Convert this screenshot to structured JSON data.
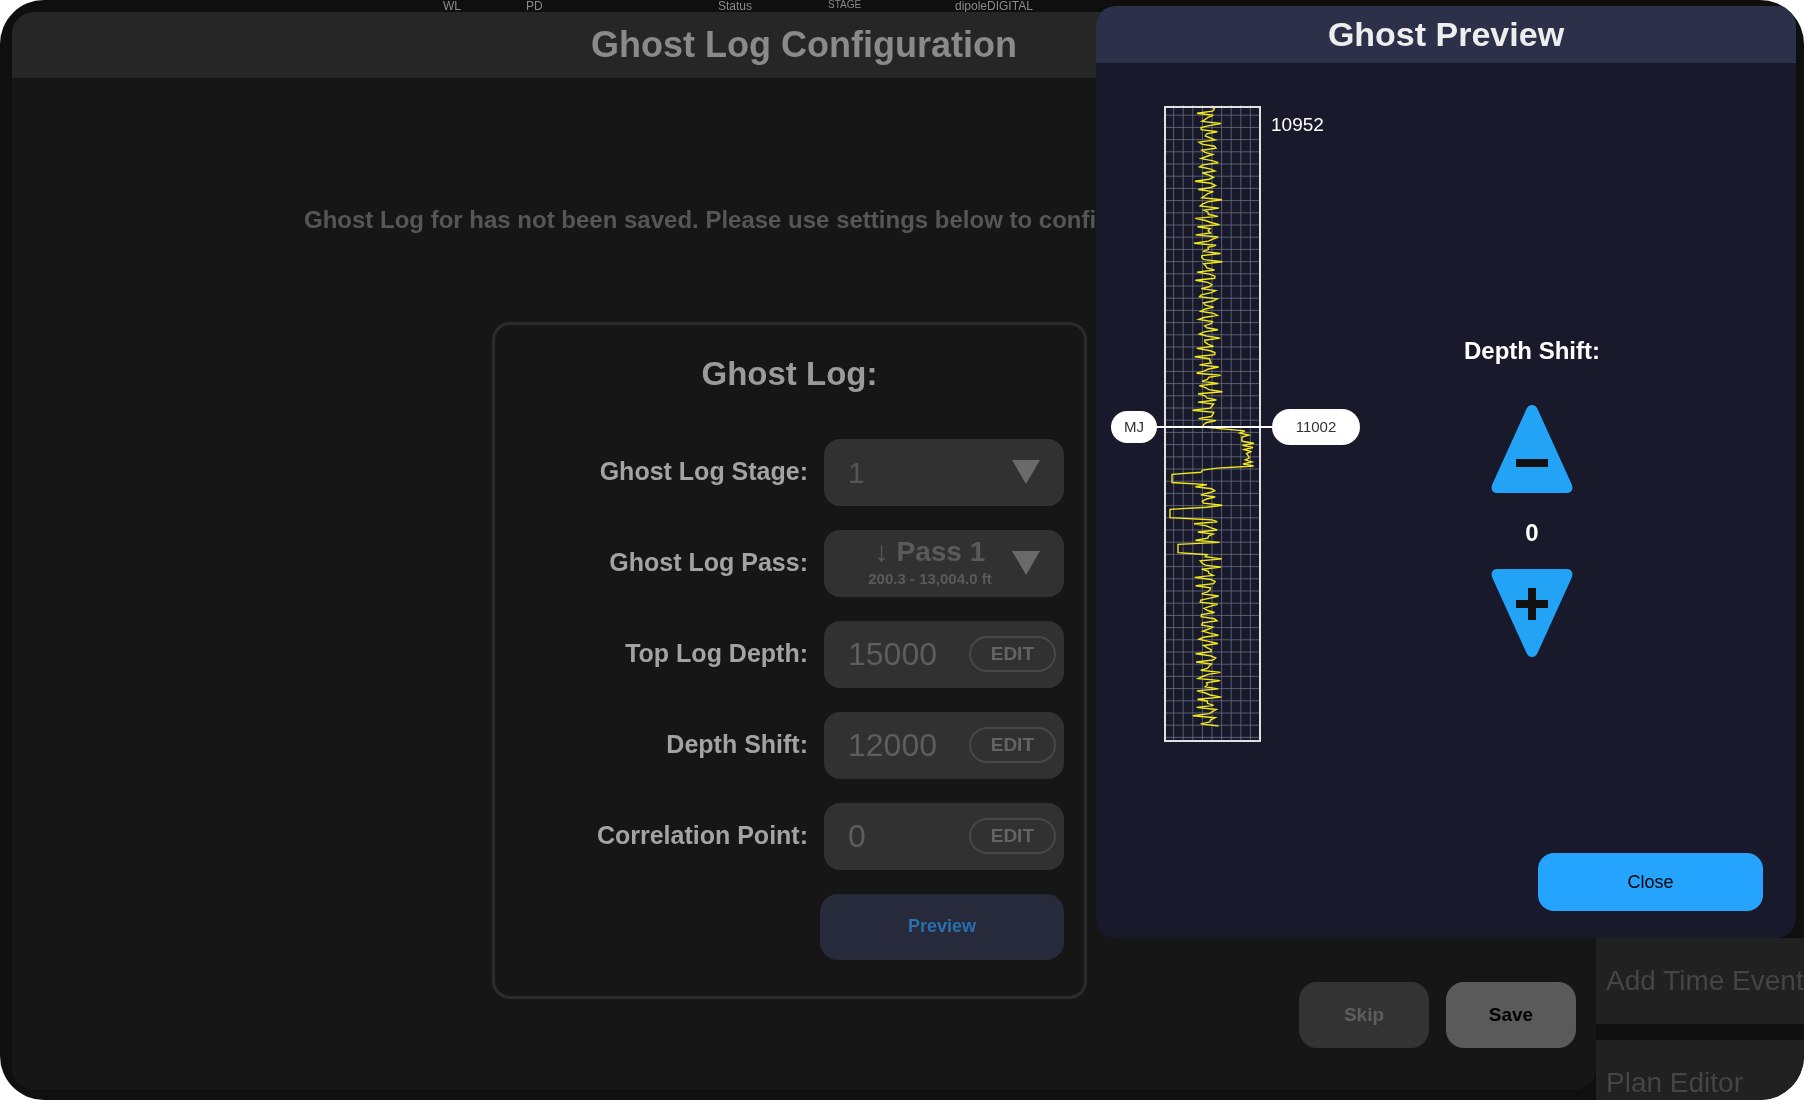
{
  "background_app": {
    "header": [
      "WL",
      "PD",
      "Status",
      "STAGE",
      "dipoleDIGITAL"
    ],
    "side_items": [
      "Add Time Event",
      "Plan Editor"
    ]
  },
  "config_dialog": {
    "title": "Ghost Log Configuration",
    "message": "Ghost Log for has not been saved. Please use settings below to confi",
    "card": {
      "title": "Ghost Log:",
      "fields": [
        {
          "kind": "dropdown",
          "label": "Ghost Log Stage:",
          "value": "1"
        },
        {
          "kind": "pass",
          "label": "Ghost Log Pass:",
          "value": "↓ Pass 1",
          "detail": "200.3 - 13,004.0 ft"
        },
        {
          "kind": "edit",
          "label": "Top Log Depth:",
          "value": "15000",
          "button": "EDIT"
        },
        {
          "kind": "edit",
          "label": "Depth Shift:",
          "value": "12000",
          "button": "EDIT"
        },
        {
          "kind": "edit",
          "label": "Correlation Point:",
          "value": "0",
          "button": "EDIT"
        }
      ],
      "preview_button": "Preview"
    },
    "buttons": [
      {
        "label": "Skip",
        "disabled": true
      },
      {
        "label": "Save",
        "disabled": false
      }
    ]
  },
  "preview_dialog": {
    "title": "Ghost Preview",
    "log": {
      "top_depth": "10952",
      "marker": "MJ",
      "marker_depth": "11002"
    },
    "depth_shift": {
      "label": "Depth Shift:",
      "value": "0"
    },
    "close_button": "Close"
  }
}
